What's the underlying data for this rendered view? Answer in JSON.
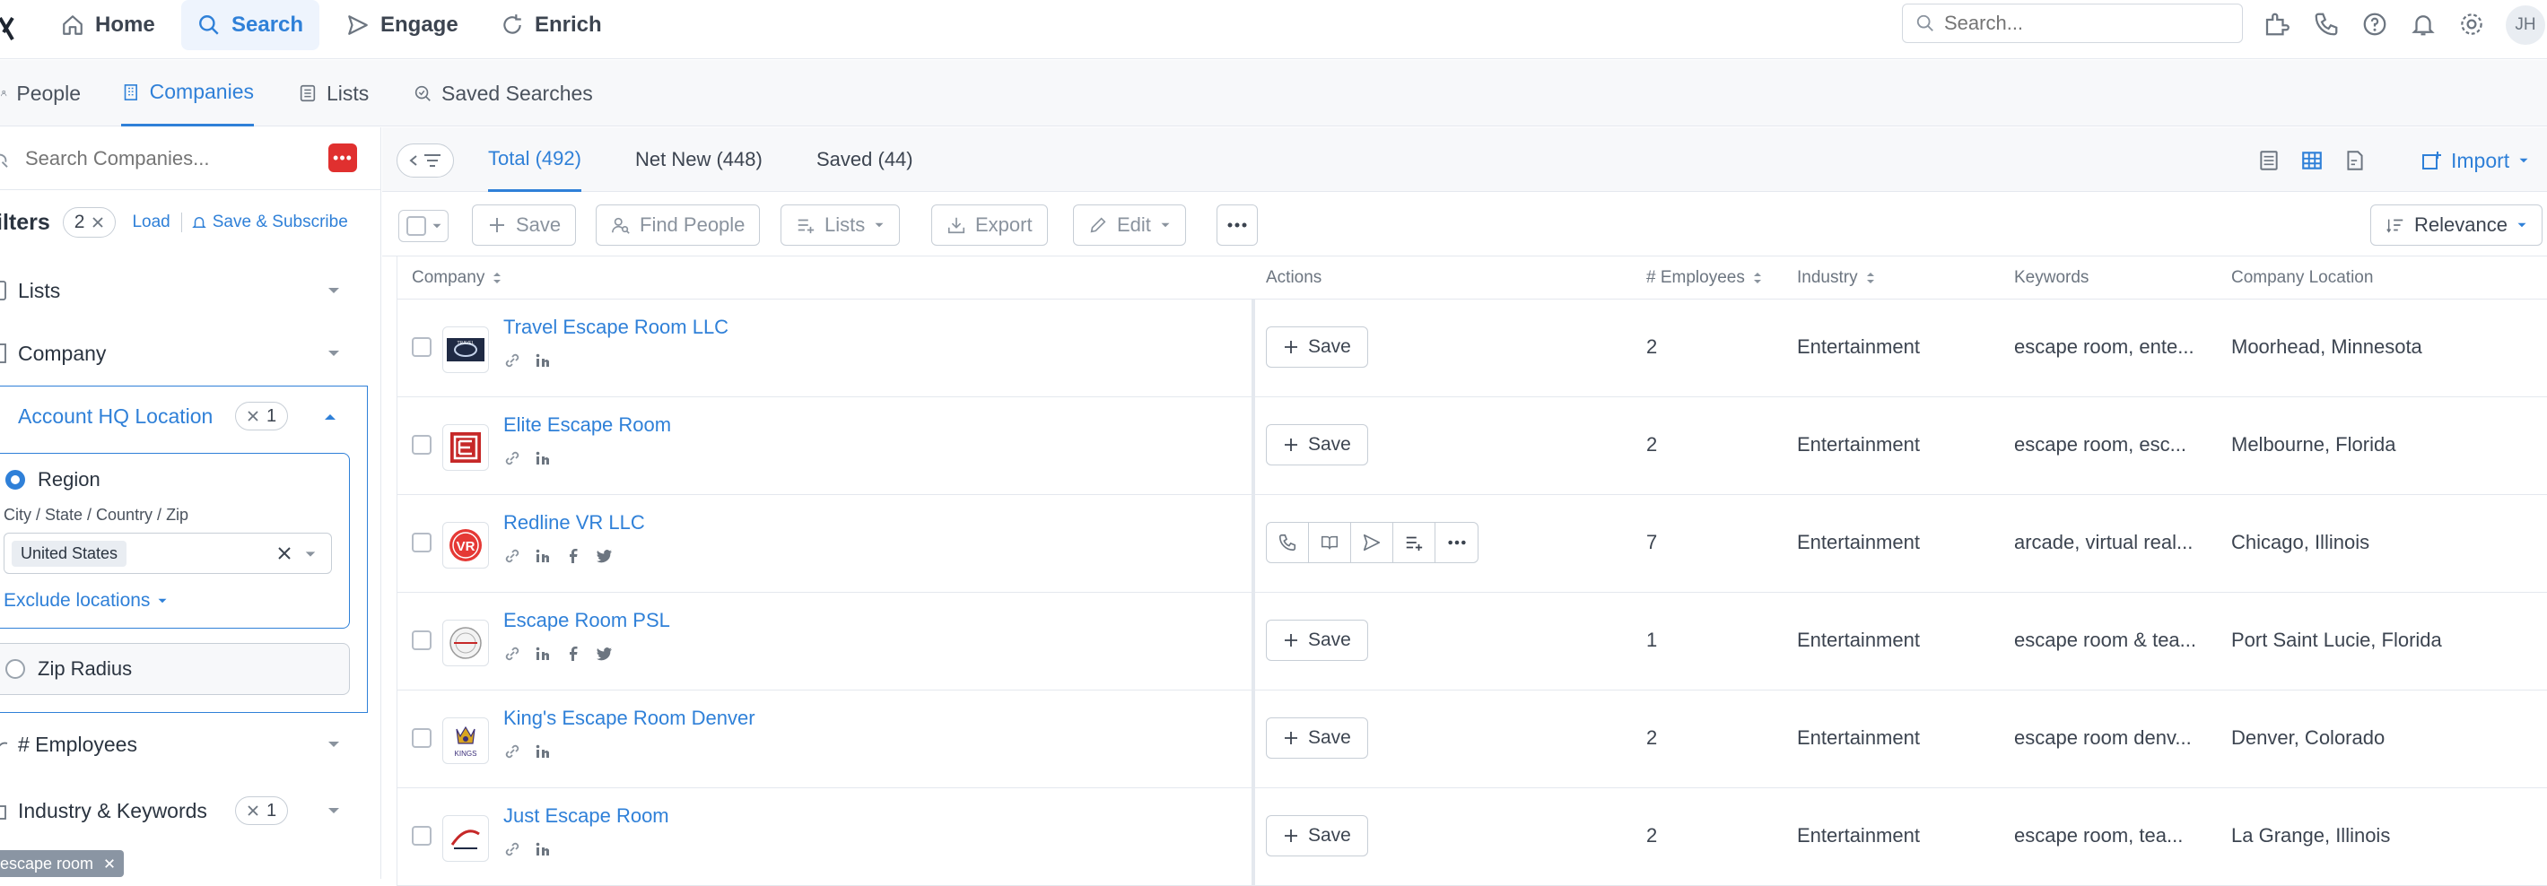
{
  "nav": {
    "items": [
      {
        "label": "Home",
        "icon": "home-icon"
      },
      {
        "label": "Search",
        "icon": "search-icon",
        "active": true
      },
      {
        "label": "Engage",
        "icon": "send-icon"
      },
      {
        "label": "Enrich",
        "icon": "refresh-icon"
      }
    ],
    "search_placeholder": "Search...",
    "avatar_initials": "JH",
    "accent_color": "#2f80d8"
  },
  "subnav": {
    "tabs": [
      {
        "label": "People",
        "icon": "person-icon"
      },
      {
        "label": "Companies",
        "icon": "building-icon",
        "active": true
      },
      {
        "label": "Lists",
        "icon": "list-icon"
      },
      {
        "label": "Saved Searches",
        "icon": "saved-search-icon"
      }
    ]
  },
  "sidebar": {
    "search_placeholder": "Search Companies...",
    "filters_title": "ilters",
    "filter_count": "2",
    "load_label": "Load",
    "save_subscribe_label": "Save & Subscribe",
    "sections": [
      {
        "label": "Lists"
      },
      {
        "label": "Company"
      }
    ],
    "location": {
      "title": "Account HQ Location",
      "count": "1",
      "region_label": "Region",
      "field_label": "City / State / Country / Zip",
      "selected_tag": "United States",
      "exclude_label": "Exclude locations",
      "zip_label": "Zip Radius"
    },
    "employees_label": "# Employees",
    "industry_label": "Industry & Keywords",
    "industry_count": "1",
    "keyword_chip": "escape room"
  },
  "main": {
    "tabs": [
      {
        "label": "Total (492)",
        "active": true
      },
      {
        "label": "Net New (448)"
      },
      {
        "label": "Saved (44)"
      }
    ],
    "import_label": "Import",
    "toolbar": {
      "save": "Save",
      "find_people": "Find People",
      "lists": "Lists",
      "export": "Export",
      "edit": "Edit",
      "sort": "Relevance"
    },
    "columns": {
      "company": "Company",
      "actions": "Actions",
      "employees": "# Employees",
      "industry": "Industry",
      "keywords": "Keywords",
      "location": "Company Location"
    },
    "save_label": "Save",
    "rows": [
      {
        "name": "Travel Escape Room LLC",
        "employees": "2",
        "industry": "Entertainment",
        "keywords": "escape room,  ente...",
        "location": "Moorhead, Minnesota",
        "socials": [
          "link-icon",
          "linkedin-icon"
        ],
        "logo": "travel-logo"
      },
      {
        "name": "Elite Escape Room",
        "employees": "2",
        "industry": "Entertainment",
        "keywords": "escape room,  esc...",
        "location": "Melbourne, Florida",
        "socials": [
          "link-icon",
          "linkedin-icon"
        ],
        "logo": "elite-logo"
      },
      {
        "name": "Redline VR LLC",
        "employees": "7",
        "industry": "Entertainment",
        "keywords": "arcade,  virtual real...",
        "location": "Chicago, Illinois",
        "socials": [
          "link-icon",
          "linkedin-icon",
          "facebook-icon",
          "twitter-icon"
        ],
        "logo": "redline-logo",
        "hover": true
      },
      {
        "name": "Escape Room PSL",
        "employees": "1",
        "industry": "Entertainment",
        "keywords": "escape room & tea...",
        "location": "Port Saint Lucie, Florida",
        "socials": [
          "link-icon",
          "linkedin-icon",
          "facebook-icon",
          "twitter-icon"
        ],
        "logo": "psl-logo"
      },
      {
        "name": "King's Escape Room Denver",
        "employees": "2",
        "industry": "Entertainment",
        "keywords": "escape room denv...",
        "location": "Denver, Colorado",
        "socials": [
          "link-icon",
          "linkedin-icon"
        ],
        "logo": "kings-logo"
      },
      {
        "name": "Just Escape Room",
        "employees": "2",
        "industry": "Entertainment",
        "keywords": "escape room,  tea...",
        "location": "La Grange, Illinois",
        "socials": [
          "link-icon",
          "linkedin-icon"
        ],
        "logo": "just-logo"
      }
    ]
  }
}
